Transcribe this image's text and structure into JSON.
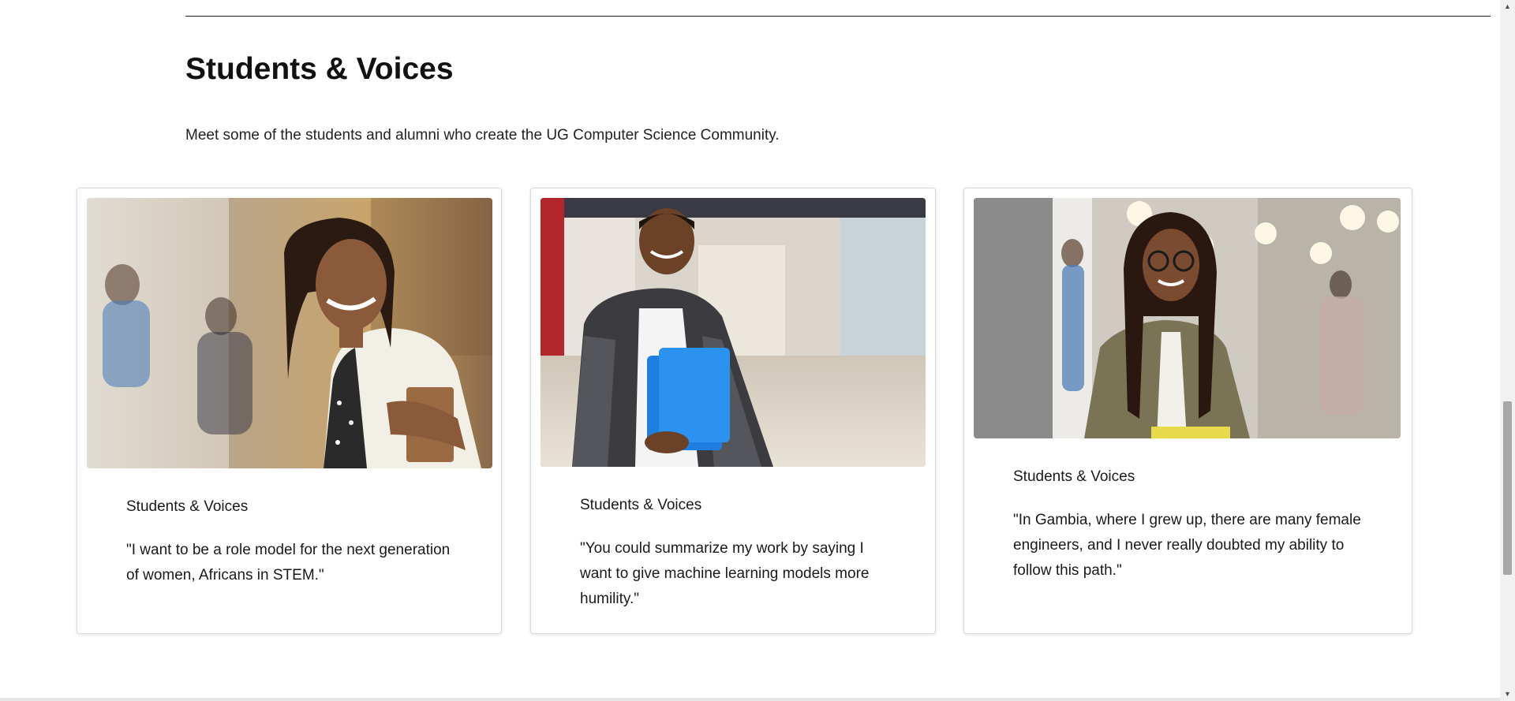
{
  "section": {
    "title": "Students & Voices",
    "intro": "Meet some of the students and alumni who create the UG Computer Science Community."
  },
  "cards": [
    {
      "kicker": "Students & Voices",
      "quote": "\"I want to be a role model for the next generation of women, Africans in STEM.\""
    },
    {
      "kicker": "Students & Voices",
      "quote": "\"You could summarize my work by saying I want to give machine learning models more humility.\""
    },
    {
      "kicker": "Students & Voices",
      "quote": "\"In Gambia, where I grew up, there are many female engineers, and I never really doubted my ability to follow this path.\""
    }
  ],
  "scrollbar": {
    "up_icon": "triangle-up-icon",
    "down_icon": "triangle-down-icon"
  },
  "colors": {
    "text": "#111111",
    "card_border": "#dadada",
    "rule": "#222222"
  }
}
